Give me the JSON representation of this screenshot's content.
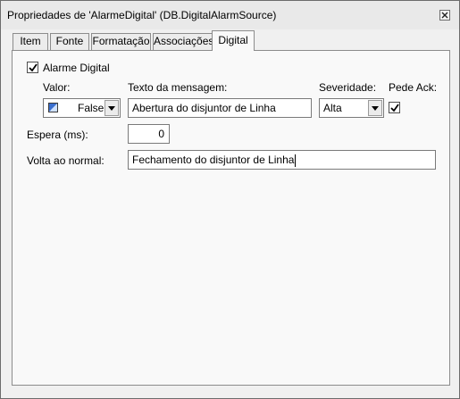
{
  "window": {
    "title": "Propriedades de 'AlarmeDigital' (DB.DigitalAlarmSource)"
  },
  "tabs": [
    {
      "label": "Item"
    },
    {
      "label": "Fonte"
    },
    {
      "label": "Formatação"
    },
    {
      "label": "Associações"
    },
    {
      "label": "Digital",
      "active": true
    }
  ],
  "digital": {
    "alarm_checkbox": {
      "label": "Alarme Digital",
      "checked": true
    },
    "value_label": "Valor:",
    "value_selected": "False",
    "message_label": "Texto da mensagem:",
    "message_value": "Abertura do disjuntor de Linha",
    "severity_label": "Severidade:",
    "severity_selected": "Alta",
    "ack_label": "Pede Ack:",
    "ack_checked": true,
    "wait_label": "Espera (ms):",
    "wait_value": "0",
    "return_label": "Volta ao normal:",
    "return_value": "Fechamento do disjuntor de Linha"
  },
  "icons": {
    "close": "close-icon",
    "check": "checkmark-icon",
    "dropdown": "chevron-down-icon",
    "value_swatch": "color-swatch-icon"
  }
}
